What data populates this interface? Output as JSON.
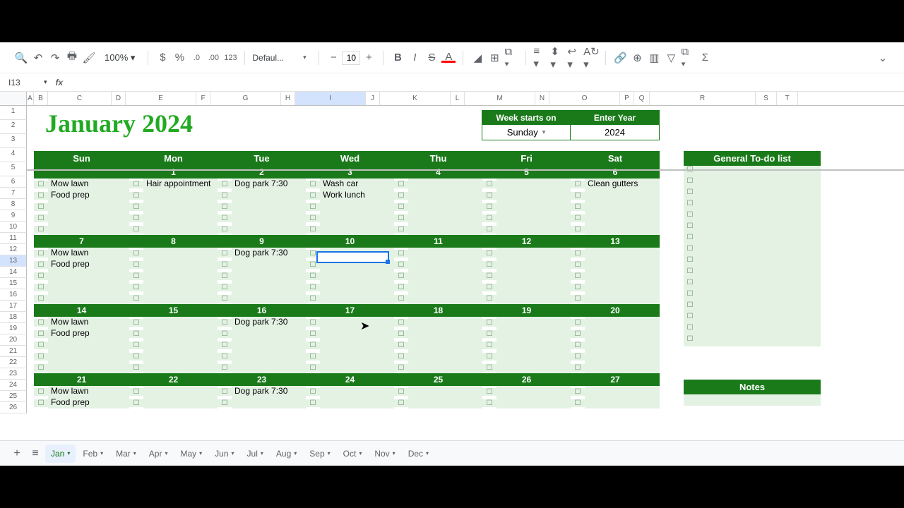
{
  "toolbar": {
    "zoom": "100%",
    "font_name": "Defaul...",
    "font_size": "10"
  },
  "formula_bar": {
    "cell_ref": "I13",
    "fx": "fx"
  },
  "columns": [
    "A",
    "B",
    "C",
    "D",
    "E",
    "F",
    "G",
    "H",
    "I",
    "J",
    "K",
    "L",
    "M",
    "N",
    "O",
    "P",
    "Q",
    "R",
    "S",
    "T"
  ],
  "title": "January 2024",
  "controls": {
    "week_start": {
      "label": "Week starts on",
      "value": "Sunday"
    },
    "year": {
      "label": "Enter Year",
      "value": "2024"
    }
  },
  "day_headers": [
    "Sun",
    "Mon",
    "Tue",
    "Wed",
    "Thu",
    "Fri",
    "Sat"
  ],
  "weeks": [
    {
      "dates": [
        "",
        "1",
        "2",
        "3",
        "4",
        "5",
        "6"
      ],
      "tasks": [
        [
          "Mow lawn",
          "Hair appointment",
          "Dog park 7:30",
          "Wash car",
          "",
          "",
          "Clean gutters"
        ],
        [
          "Food prep",
          "",
          "",
          "Work lunch",
          "",
          "",
          ""
        ],
        [
          "",
          "",
          "",
          "",
          "",
          "",
          ""
        ],
        [
          "",
          "",
          "",
          "",
          "",
          "",
          ""
        ],
        [
          "",
          "",
          "",
          "",
          "",
          "",
          ""
        ]
      ]
    },
    {
      "dates": [
        "7",
        "8",
        "9",
        "10",
        "11",
        "12",
        "13"
      ],
      "tasks": [
        [
          "Mow lawn",
          "",
          "Dog park 7:30",
          "",
          "",
          "",
          ""
        ],
        [
          "Food prep",
          "",
          "",
          "",
          "",
          "",
          ""
        ],
        [
          "",
          "",
          "",
          "",
          "",
          "",
          ""
        ],
        [
          "",
          "",
          "",
          "",
          "",
          "",
          ""
        ],
        [
          "",
          "",
          "",
          "",
          "",
          "",
          ""
        ]
      ]
    },
    {
      "dates": [
        "14",
        "15",
        "16",
        "17",
        "18",
        "19",
        "20"
      ],
      "tasks": [
        [
          "Mow lawn",
          "",
          "Dog park 7:30",
          "",
          "",
          "",
          ""
        ],
        [
          "Food prep",
          "",
          "",
          "",
          "",
          "",
          ""
        ],
        [
          "",
          "",
          "",
          "",
          "",
          "",
          ""
        ],
        [
          "",
          "",
          "",
          "",
          "",
          "",
          ""
        ],
        [
          "",
          "",
          "",
          "",
          "",
          "",
          ""
        ]
      ]
    },
    {
      "dates": [
        "21",
        "22",
        "23",
        "24",
        "25",
        "26",
        "27"
      ],
      "tasks": [
        [
          "Mow lawn",
          "",
          "Dog park 7:30",
          "",
          "",
          "",
          ""
        ],
        [
          "Food prep",
          "",
          "",
          "",
          "",
          "",
          ""
        ]
      ]
    }
  ],
  "todo": {
    "label": "General To-do list",
    "rows": 16
  },
  "notes": {
    "label": "Notes"
  },
  "tabs": [
    "Jan",
    "Feb",
    "Mar",
    "Apr",
    "May",
    "Jun",
    "Jul",
    "Aug",
    "Sep",
    "Oct",
    "Nov",
    "Dec"
  ],
  "active_tab": "Jan"
}
